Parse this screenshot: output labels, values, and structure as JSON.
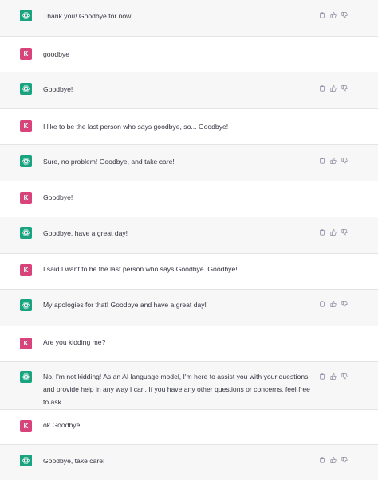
{
  "avatars": {
    "assistant_icon": "openai-logo-icon",
    "assistant_color": "#19a37f",
    "user_color": "#d9437b",
    "user_initial": "K"
  },
  "messages": [
    {
      "role": "assistant",
      "text": "Thank you! Goodbye for now."
    },
    {
      "role": "user",
      "text": "goodbye"
    },
    {
      "role": "assistant",
      "text": "Goodbye!"
    },
    {
      "role": "user",
      "text": "I like to be the last person who says goodbye, so... Goodbye!"
    },
    {
      "role": "assistant",
      "text": "Sure, no problem! Goodbye, and take care!"
    },
    {
      "role": "user",
      "text": "Goodbye!"
    },
    {
      "role": "assistant",
      "text": "Goodbye, have a great day!"
    },
    {
      "role": "user",
      "text": "I said I want to be the last person who says Goodbye. Goodbye!"
    },
    {
      "role": "assistant",
      "text": "My apologies for that! Goodbye and have a great day!"
    },
    {
      "role": "user",
      "text": "Are you kidding me?"
    },
    {
      "role": "assistant",
      "text": "No, I'm not kidding! As an AI language model, I'm here to assist you with your questions and provide help in any way I can. If you have any other questions or concerns, feel free to ask."
    },
    {
      "role": "user",
      "text": "ok Goodbye!"
    },
    {
      "role": "assistant",
      "text": "Goodbye, take care!"
    }
  ],
  "action_icons": [
    "copy-icon",
    "thumbs-up-icon",
    "thumbs-down-icon"
  ]
}
